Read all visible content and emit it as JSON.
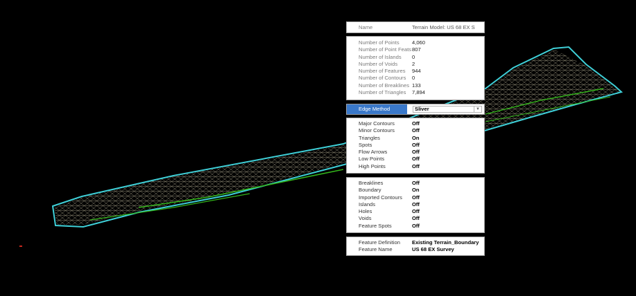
{
  "colors": {
    "background": "#000000",
    "boundary": "#3fd0d8",
    "mesh": "#8a8570",
    "breaklines": "#33b51b"
  },
  "properties": {
    "name": {
      "label": "Name",
      "value": "Terrain Model: US 68 EX S"
    },
    "stats": [
      {
        "label": "Number of Points",
        "value": "4,060"
      },
      {
        "label": "Number of Point Feats",
        "value": "807"
      },
      {
        "label": "Number of Islands",
        "value": "0"
      },
      {
        "label": "Number of Voids",
        "value": "2"
      },
      {
        "label": "Number of Features",
        "value": "944"
      },
      {
        "label": "Number of Contours",
        "value": "0"
      },
      {
        "label": "Number of Breaklines",
        "value": "133"
      },
      {
        "label": "Number of Triangles",
        "value": "7,894"
      }
    ],
    "edge_method": {
      "label": "Edge Method",
      "value": "Sliver"
    },
    "display": [
      {
        "label": "Major Contours",
        "value": "Off"
      },
      {
        "label": "Minor Contours",
        "value": "Off"
      },
      {
        "label": "Triangles",
        "value": "On"
      },
      {
        "label": "Spots",
        "value": "Off"
      },
      {
        "label": "Flow Arrows",
        "value": "Off"
      },
      {
        "label": "Low Points",
        "value": "Off"
      },
      {
        "label": "High Points",
        "value": "Off"
      }
    ],
    "features": [
      {
        "label": "Breaklines",
        "value": "Off"
      },
      {
        "label": "Boundary",
        "value": "On"
      },
      {
        "label": "Imported Contours",
        "value": "Off"
      },
      {
        "label": "Islands",
        "value": "Off"
      },
      {
        "label": "Holes",
        "value": "Off"
      },
      {
        "label": "Voids",
        "value": "Off"
      },
      {
        "label": "Feature Spots",
        "value": "Off"
      }
    ],
    "feature_definition": {
      "label": "Feature Definition",
      "value": "Existing Terrain_Boundary"
    },
    "feature_name": {
      "label": "Feature Name",
      "value": "US 68 EX Survey"
    }
  }
}
